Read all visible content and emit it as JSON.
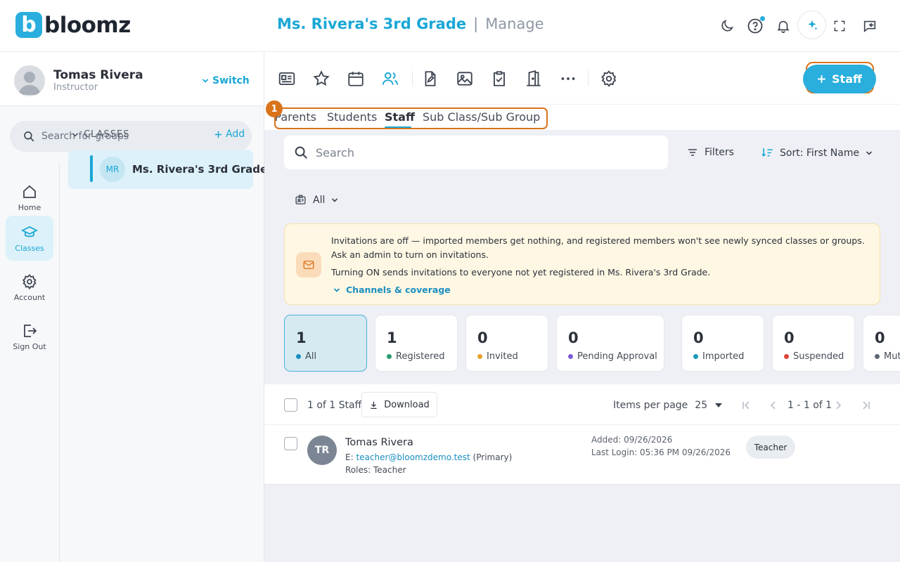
{
  "brand": {
    "name": "bloomz",
    "mark": "b"
  },
  "header": {
    "class_name": "Ms. Rivera's 3rd Grade",
    "separator": "|",
    "section": "Manage"
  },
  "user": {
    "name": "Tomas Rivera",
    "role": "Instructor",
    "switch_label": "Switch"
  },
  "group_search": {
    "placeholder": "Search for groups"
  },
  "nav": {
    "items": [
      {
        "label": "Home"
      },
      {
        "label": "Classes"
      },
      {
        "label": "Account"
      },
      {
        "label": "Sign Out"
      }
    ]
  },
  "classes": {
    "heading": "CLASSES",
    "add_label": "Add",
    "items": [
      {
        "initials": "MR",
        "name": "Ms. Rivera's 3rd Grade"
      }
    ]
  },
  "primary_button": {
    "label": "Staff"
  },
  "annotation": {
    "number": "1"
  },
  "tabs": [
    {
      "label": "Parents"
    },
    {
      "label": "Students"
    },
    {
      "label": "Staff"
    },
    {
      "label": "Sub Class/Sub Group"
    }
  ],
  "search": {
    "placeholder": "Search"
  },
  "filters_label": "Filters",
  "sort_label": "Sort: First Name",
  "role_filter": {
    "value": "All"
  },
  "notice": {
    "line1": "Invitations are off — imported members get nothing, and registered members won't see newly synced classes or groups.",
    "line2": "Ask an admin to turn on invitations.",
    "line3": "Turning ON sends invitations to everyone not yet registered in Ms. Rivera's 3rd Grade.",
    "link": "Channels & coverage"
  },
  "stats": [
    {
      "count": "1",
      "label": "All",
      "color": "#1a8fc0"
    },
    {
      "count": "1",
      "label": "Registered",
      "color": "#2a9d6f"
    },
    {
      "count": "0",
      "label": "Invited",
      "color": "#e8a02a"
    },
    {
      "count": "0",
      "label": "Pending Approval",
      "color": "#7c5ad9"
    },
    {
      "count": "0",
      "label": "Imported",
      "color": "#1a9ab8"
    },
    {
      "count": "0",
      "label": "Suspended",
      "color": "#e0443a"
    },
    {
      "count": "0",
      "label": "Mut",
      "color": "#5e6673"
    }
  ],
  "list": {
    "count_text": "1 of 1 Staff",
    "download_label": "Download",
    "items_per_page_label": "Items per page",
    "items_per_page_value": "25",
    "page_range": "1 - 1 of 1"
  },
  "rows": [
    {
      "initials": "TR",
      "name": "Tomas Rivera",
      "email_prefix": "E:",
      "email": "teacher@bloomzdemo.test",
      "email_suffix": "(Primary)",
      "roles": "Roles: Teacher",
      "added": "Added: 09/26/2026",
      "last_login": "Last Login: 05:36 PM 09/26/2026",
      "role_chip": "Teacher"
    }
  ],
  "colors": {
    "accent": "#29aede",
    "accent_text": "#1aa7d6",
    "annotation": "#d9731a",
    "notice_bg": "#fef7e3"
  }
}
